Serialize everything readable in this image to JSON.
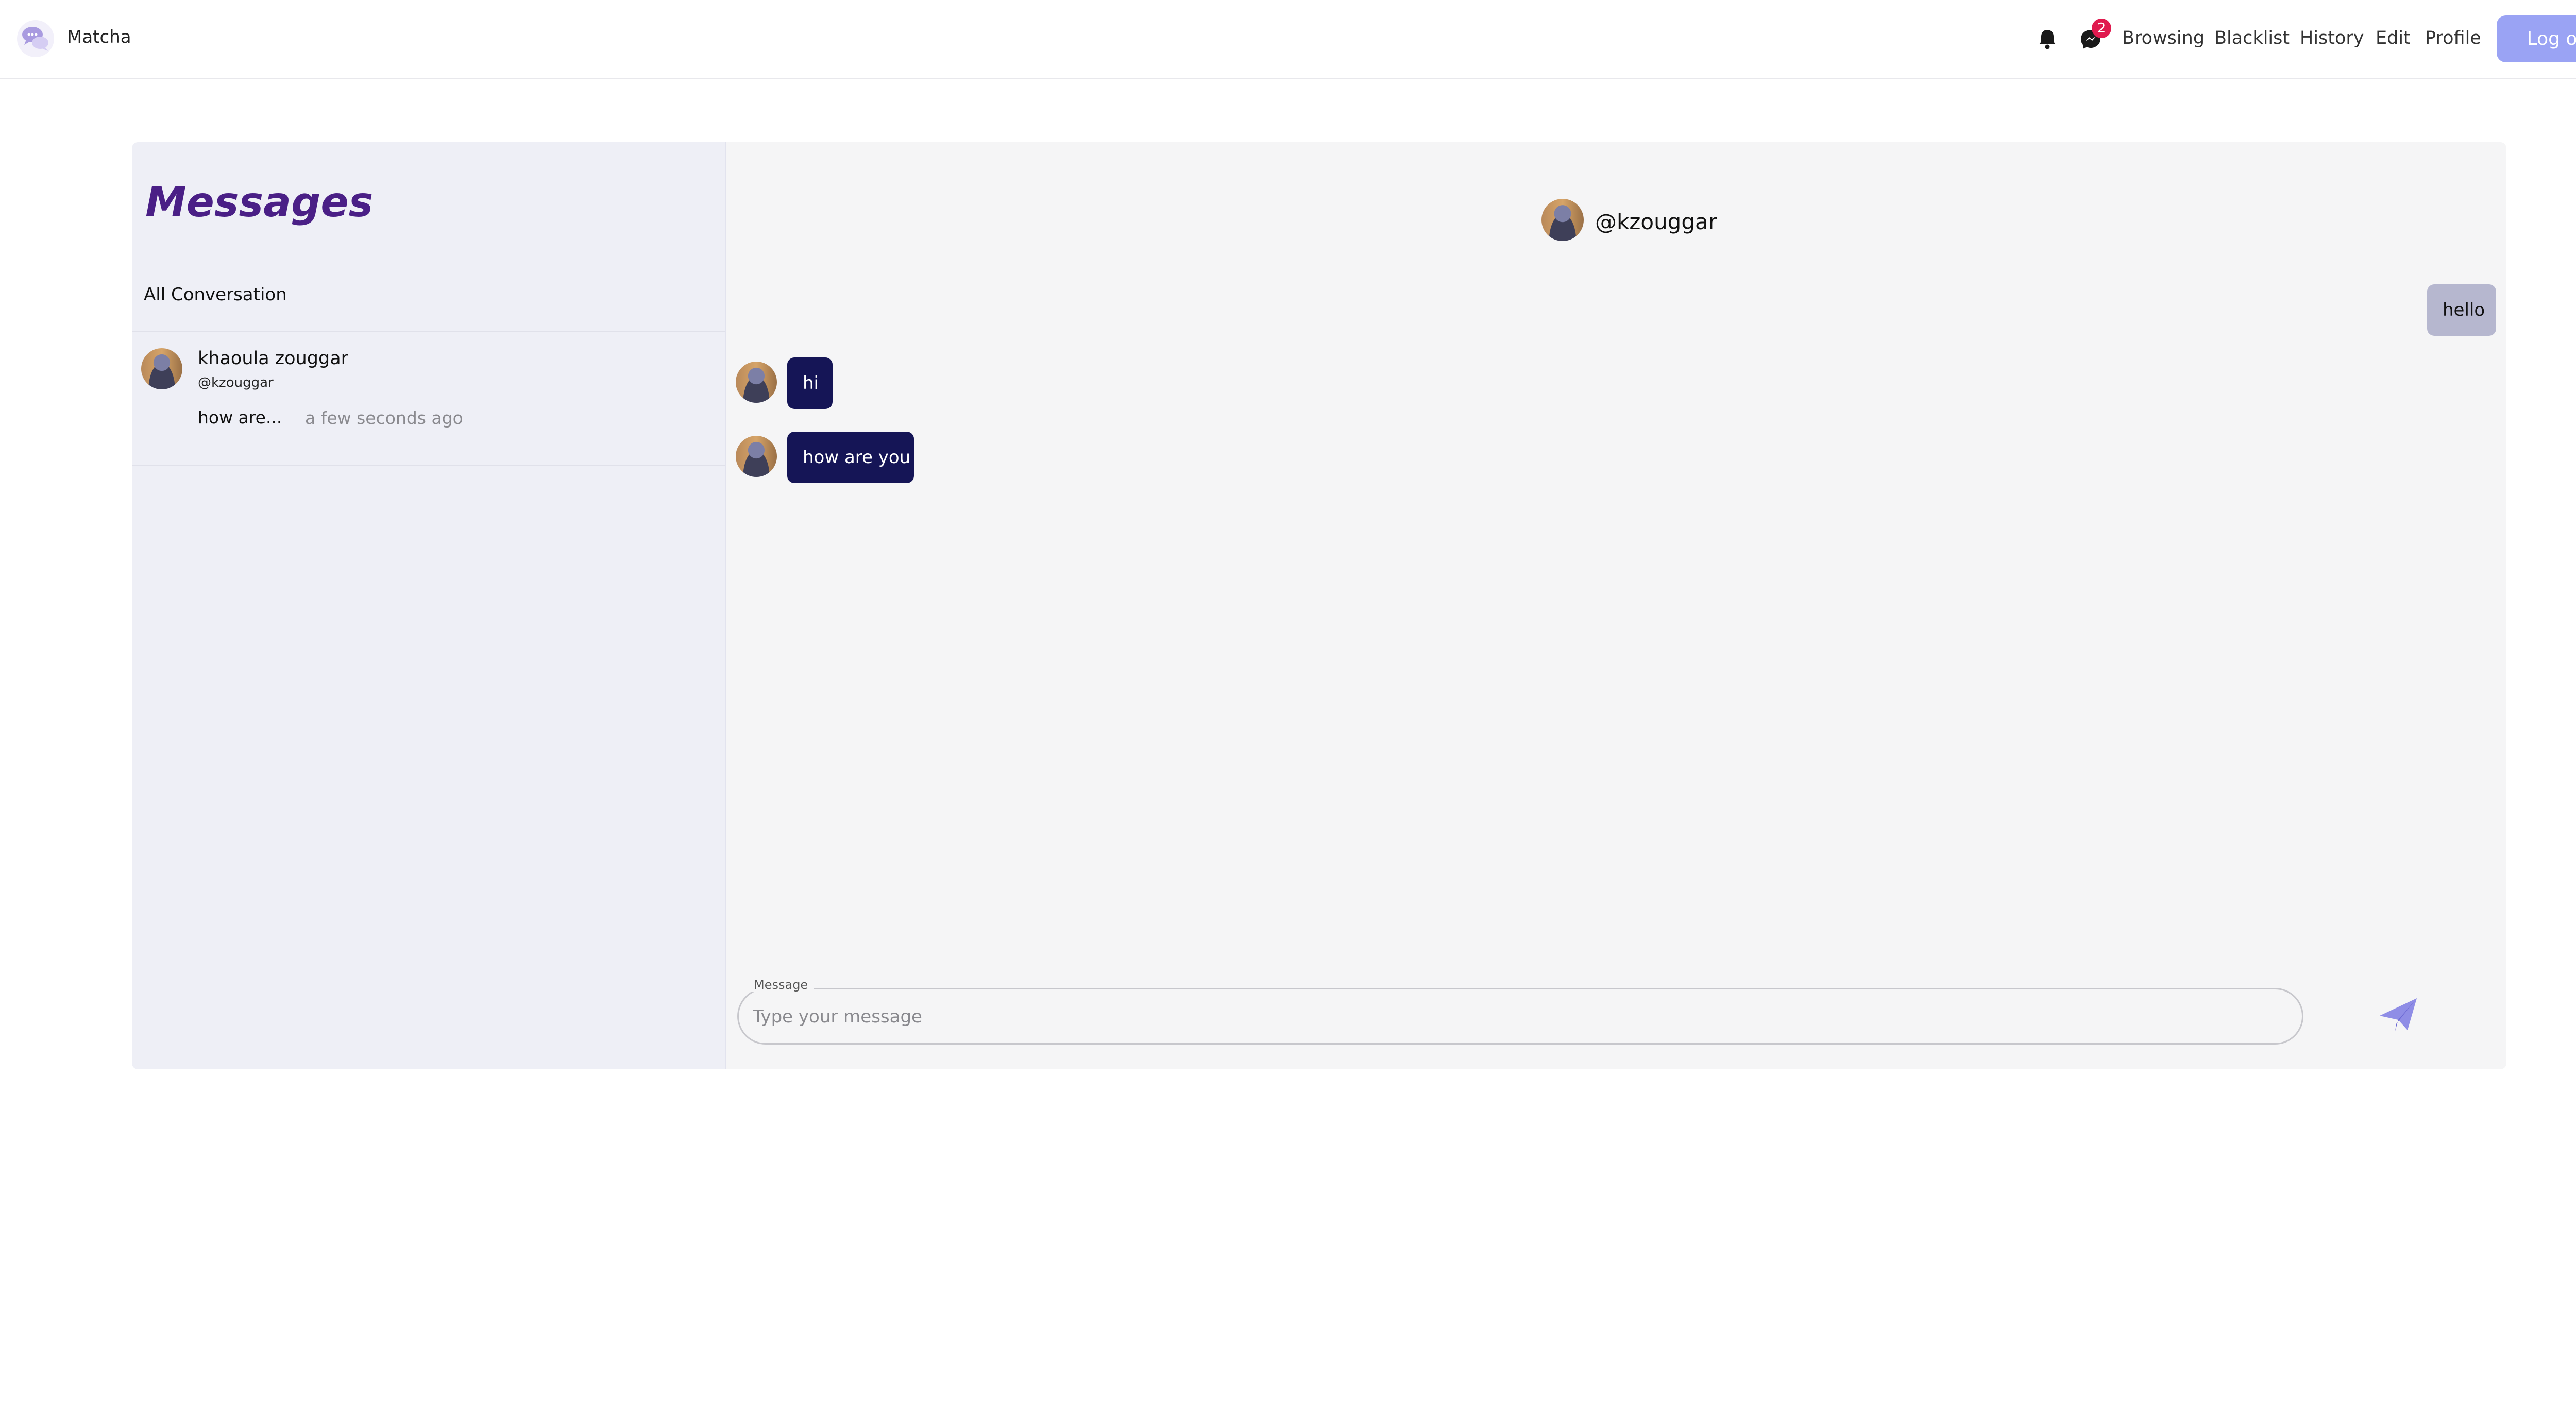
{
  "brand": {
    "name": "Matcha"
  },
  "nav": {
    "messages_badge": "2",
    "links": [
      "Browsing",
      "Blacklist",
      "History",
      "Edit",
      "Profile"
    ],
    "logout_label": "Log out"
  },
  "sidebar": {
    "title": "Messages",
    "section_label": "All Conversation",
    "conversations": [
      {
        "name": "khaoula zouggar",
        "handle": "@kzouggar",
        "preview": "how are...",
        "time": "a few seconds ago"
      }
    ]
  },
  "chat": {
    "header_handle": "@kzouggar",
    "messages": [
      {
        "direction": "outgoing",
        "text": "hello"
      },
      {
        "direction": "incoming",
        "text": "hi"
      },
      {
        "direction": "incoming",
        "text": "how are you"
      }
    ],
    "input_label": "Message",
    "input_placeholder": "Type your message",
    "input_value": ""
  },
  "colors": {
    "accent": "#9aa3f4",
    "title": "#4a1f86",
    "incoming_bubble": "#151556",
    "outgoing_bubble": "#b6b7cf",
    "badge": "#e01a4f"
  },
  "icons": [
    "chat-bubbles-logo-icon",
    "bell-icon",
    "messenger-icon",
    "send-icon"
  ]
}
